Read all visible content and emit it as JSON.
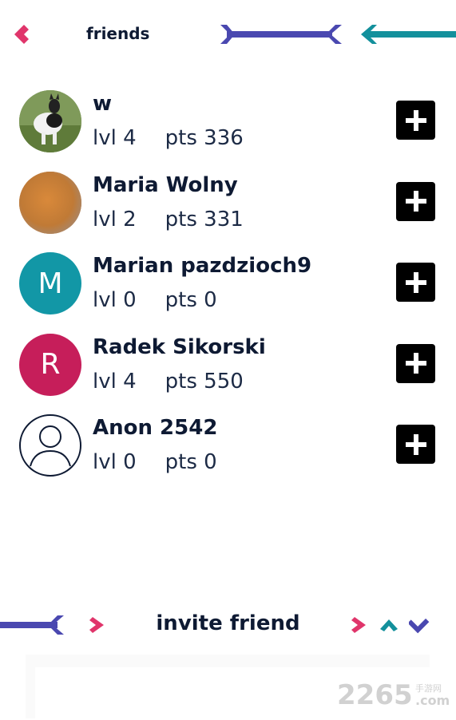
{
  "header": {
    "title": "friends",
    "back_icon": "chevron-left-icon"
  },
  "friends": [
    {
      "name": "w",
      "level": "lvl 4",
      "points": "pts 336",
      "avatar": "photo-cat"
    },
    {
      "name": "Maria Wolny",
      "level": "lvl 2",
      "points": "pts 331",
      "avatar": "photo-orange"
    },
    {
      "name": "Marian pazdzioch9",
      "level": "lvl 0",
      "points": "pts 0",
      "avatar": "M",
      "avatar_color": "#1297a6"
    },
    {
      "name": "Radek Sikorski",
      "level": "lvl 4",
      "points": "pts 550",
      "avatar": "R",
      "avatar_color": "#c61e5a"
    },
    {
      "name": "Anon 2542",
      "level": "lvl 0",
      "points": "pts 0",
      "avatar": "person-outline-icon"
    }
  ],
  "invite": {
    "title": "invite friend"
  },
  "watermark": {
    "number": "2265",
    "dot": ".com",
    "chinese": "手游网"
  },
  "colors": {
    "pink": "#e0356b",
    "indigo": "#4a48b0",
    "teal": "#13909c",
    "navy": "#0e1a33"
  }
}
